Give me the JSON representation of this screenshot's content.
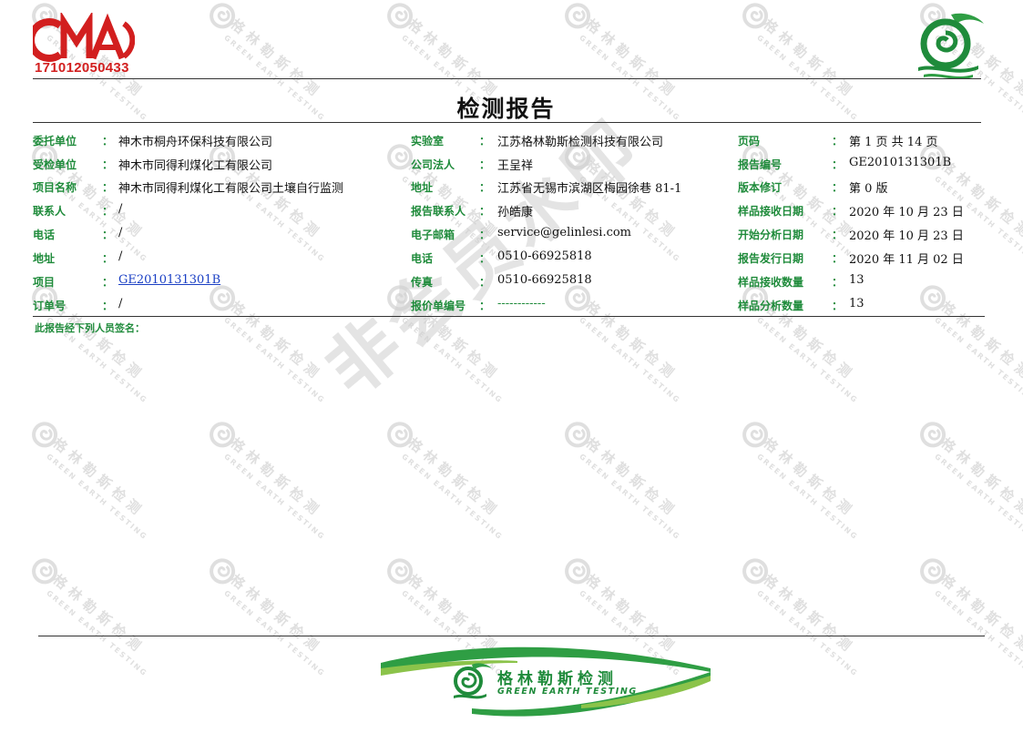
{
  "header": {
    "cma_mark": "CMA",
    "cma_number": "171012050433",
    "title": "检测报告"
  },
  "watermark": {
    "tile_cn": "格林勒斯检测",
    "tile_en": "GREEN EARTH TESTING",
    "diagonal_text": "非会员水印"
  },
  "info": {
    "rows": [
      {
        "l1": "委托单位",
        "v1": "神木市桐舟环保科技有限公司",
        "l2": "实验室",
        "v2": "江苏格林勒斯检测科技有限公司",
        "l3": "页码",
        "v3": "第 1 页 共 14 页"
      },
      {
        "l1": "受检单位",
        "v1": "神木市同得利煤化工有限公司",
        "l2": "公司法人",
        "v2": "王呈祥",
        "l3": "报告编号",
        "v3": "GE2010131301B"
      },
      {
        "l1": "项目名称",
        "v1": "神木市同得利煤化工有限公司土壤自行监测",
        "l2": "地址",
        "v2": "江苏省无锡市滨湖区梅园徐巷 81-1",
        "l3": "版本修订",
        "v3": "第 0 版"
      },
      {
        "l1": "联系人",
        "v1": "/",
        "l2": "报告联系人",
        "v2": "孙皓康",
        "l3": "样品接收日期",
        "v3": "2020 年 10 月 23 日"
      },
      {
        "l1": "电话",
        "v1": "/",
        "l2": "电子邮箱",
        "v2": "service@gelinlesi.com",
        "l3": "开始分析日期",
        "v3": "2020 年 10 月 23 日"
      },
      {
        "l1": "地址",
        "v1": "/",
        "l2": "电话",
        "v2": "0510-66925818",
        "l3": "报告发行日期",
        "v3": "2020 年 11 月 02 日"
      },
      {
        "l1": "项目",
        "v1": "GE2010131301B",
        "l2": "传真",
        "v2": "0510-66925818",
        "l3": "样品接收数量",
        "v3": "13"
      },
      {
        "l1": "订单号",
        "v1": "/",
        "l2": "报价单编号",
        "v2": "------------",
        "l3": "样品分析数量",
        "v3": "13"
      }
    ],
    "colon": "："
  },
  "signature_note": "此报告经下列人员签名：",
  "footer": {
    "brand_cn": "格林勒斯检测",
    "brand_en": "GREEN EARTH TESTING"
  },
  "colors": {
    "brand_green": "#1f8b3b",
    "cma_red": "#d21f1f",
    "link_blue": "#1a3fc4"
  }
}
